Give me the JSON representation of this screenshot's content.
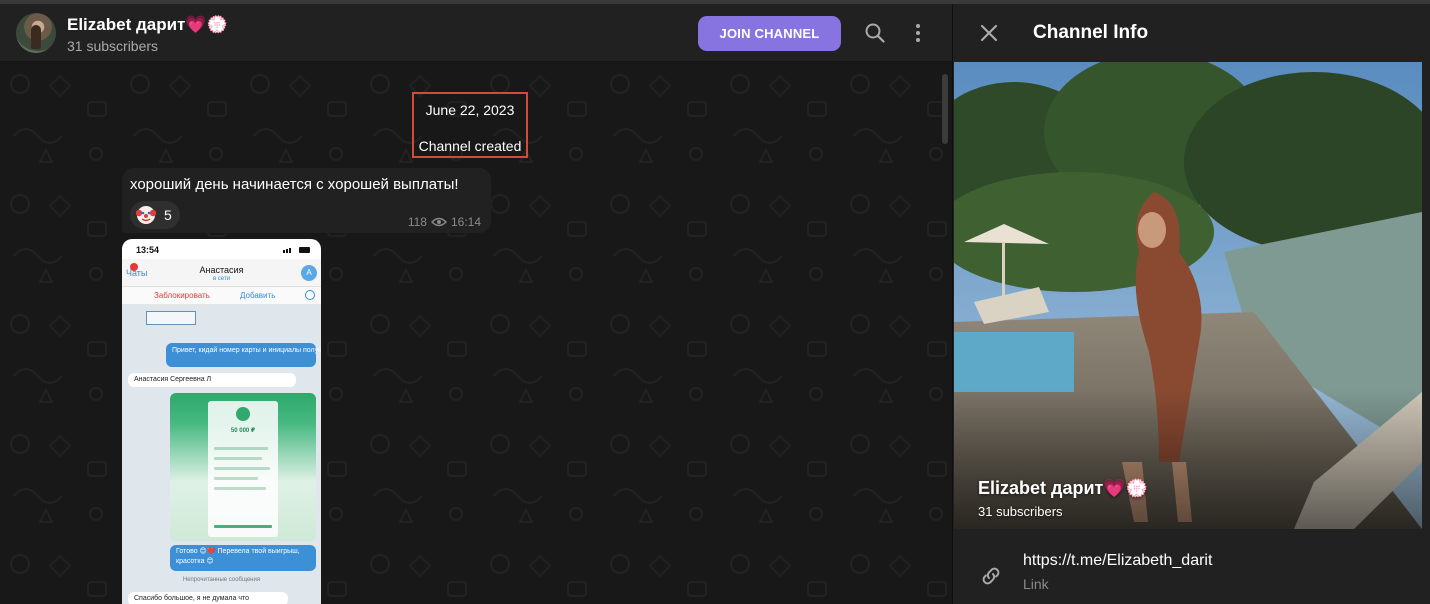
{
  "header": {
    "channel_name": "Elizabet дарит💗💮",
    "subscribers": "31 subscribers",
    "join_label": "JOIN CHANNEL"
  },
  "service": {
    "date": "June 22, 2023",
    "text": "Channel created"
  },
  "message": {
    "text": "хороший день начинается с хорошей выплаты!",
    "reaction_emoji": "clown-face",
    "reaction_count": "5",
    "views": "118",
    "time": "16:14"
  },
  "screenshot": {
    "status_time": "13:54",
    "back_label": "Чаты",
    "contact_name": "Анастасия",
    "contact_status": "в сети",
    "block_label": "Заблокировать",
    "add_label": "Добавить",
    "avatar_letter": "А",
    "outgoing_text": "Привет, кидай номер карты и инициалы получателя 😊",
    "incoming_text": "Анастасия Сергеевна Л",
    "payment_amount": "50 000 ₽",
    "reply_text": "Готово 😊❤️ Перевела твой выигрыш, красотка 😊",
    "unread_label": "Непрочитанные сообщения",
    "last_text": "Спасибо большое, я не думала что"
  },
  "panel": {
    "title": "Channel Info",
    "cover_title": "Elizabet дарит💗💮",
    "cover_subscribers": "31 subscribers",
    "link_url": "https://t.me/Elizabeth_darit",
    "link_caption": "Link"
  },
  "icons": {
    "search": "search-icon",
    "more": "more-vertical-icon",
    "close": "close-icon",
    "link": "link-icon",
    "views": "eye-icon"
  },
  "colors": {
    "accent": "#8774e1",
    "background": "#181818",
    "surface": "#212121",
    "highlight_border": "#d24a3c"
  }
}
